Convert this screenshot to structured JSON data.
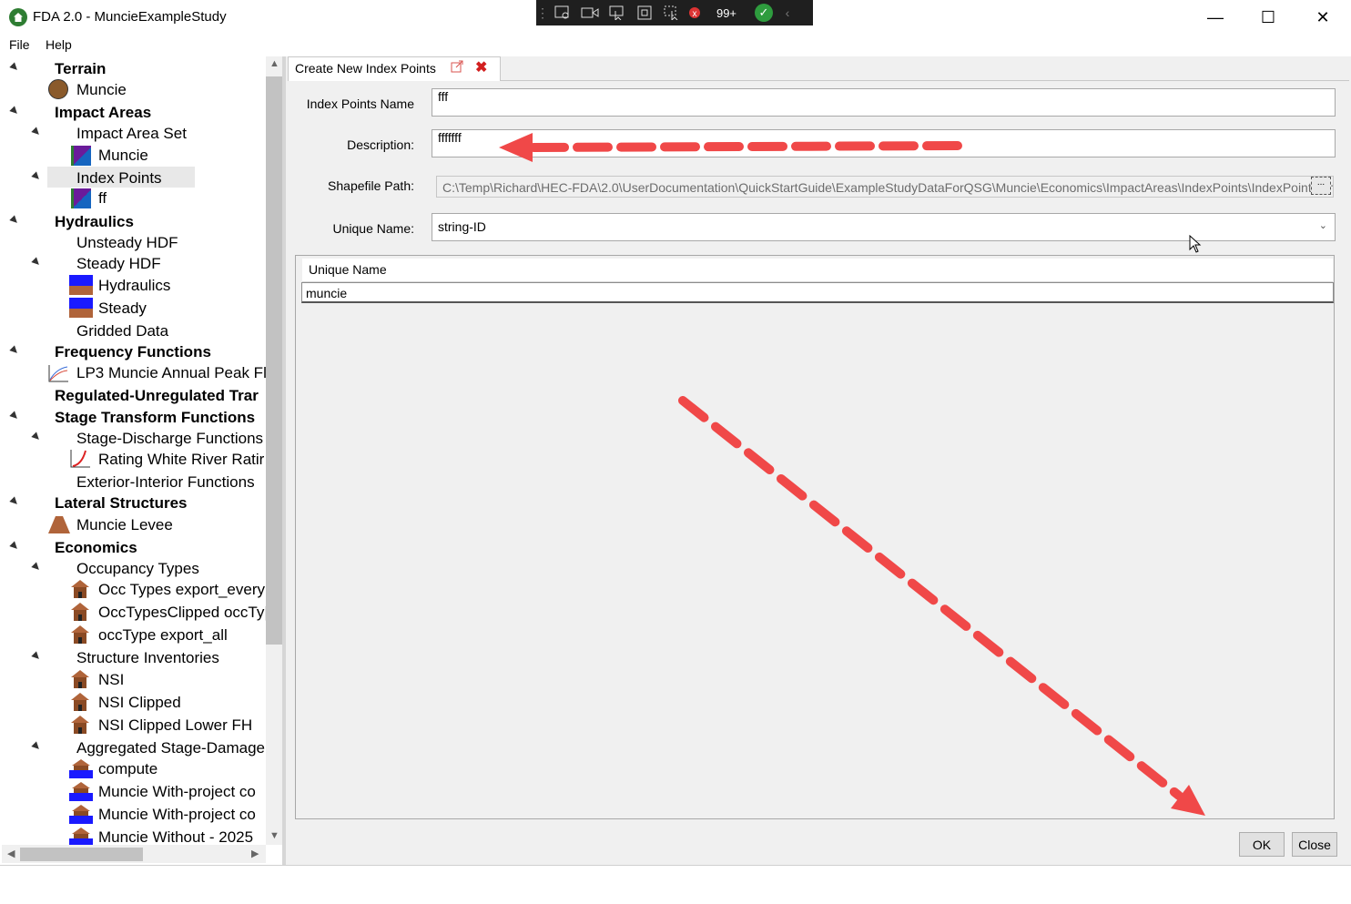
{
  "window": {
    "title": "FDA 2.0 - MuncieExampleStudy",
    "minimize": "—",
    "maximize": "☐",
    "close": "✕"
  },
  "float_toolbar": {
    "count_badge": "99+"
  },
  "menu": {
    "file": "File",
    "help": "Help"
  },
  "tree": {
    "terrain": "Terrain",
    "terrain_muncie": "Muncie",
    "impact_areas": "Impact Areas",
    "impact_area_set": "Impact Area Set",
    "impact_muncie": "Muncie",
    "index_points": "Index Points",
    "index_ff": "ff",
    "hydraulics": "Hydraulics",
    "unsteady_hdf": "Unsteady HDF",
    "steady_hdf": "Steady HDF",
    "hyd_hydraulics": "Hydraulics",
    "hyd_steady": "Steady",
    "gridded_data": "Gridded Data",
    "frequency_functions": "Frequency Functions",
    "lp3": "LP3 Muncie Annual Peak Fl",
    "regulated": "Regulated-Unregulated Trar",
    "stage_transform": "Stage Transform Functions",
    "stage_discharge": "Stage-Discharge Functions",
    "rating": "Rating White River Ratir",
    "exterior_interior": "Exterior-Interior Functions",
    "lateral_structures": "Lateral Structures",
    "muncie_levee": "Muncie Levee",
    "economics": "Economics",
    "occupancy_types": "Occupancy Types",
    "occ1": "Occ Types export_every",
    "occ2": "OccTypesClipped occTy|",
    "occ3": "occType export_all",
    "structure_inventories": "Structure Inventories",
    "nsi": "NSI",
    "nsi_clipped": "NSI Clipped",
    "nsi_clipped_lower": "NSI Clipped Lower FH",
    "aggregated": "Aggregated Stage-Damage",
    "compute": "compute",
    "muncie_with1": "Muncie With-project co",
    "muncie_with2": "Muncie With-project co",
    "muncie_without": "Muncie Without - 2025"
  },
  "tab": {
    "label": "Create New Index Points"
  },
  "form": {
    "name_label": "Index Points Name",
    "name_value": "fff",
    "desc_label": "Description:",
    "desc_value": "fffffff",
    "shape_label": "Shapefile Path:",
    "shape_value": "C:\\Temp\\Richard\\HEC-FDA\\2.0\\UserDocumentation\\QuickStartGuide\\ExampleStudyDataForQSG\\Muncie\\Economics\\ImpactAreas\\IndexPoints\\IndexPoints.shp",
    "browse": "...",
    "unique_label": "Unique Name:",
    "unique_value": "string-ID",
    "grid_header": "Unique Name",
    "grid_cell": "muncie"
  },
  "buttons": {
    "ok": "OK",
    "close": "Close"
  },
  "colors": {
    "accent_arrow": "#f04848",
    "selection": "#e8e8e8"
  }
}
